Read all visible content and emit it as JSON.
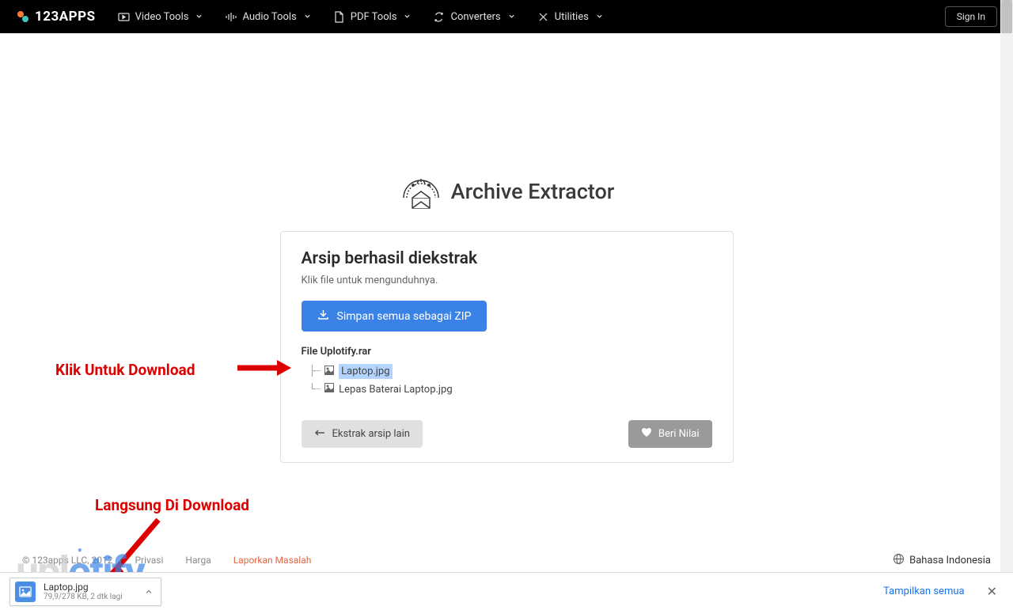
{
  "header": {
    "logo_text": "123APPS",
    "nav": {
      "video": "Video Tools",
      "audio": "Audio Tools",
      "pdf": "PDF Tools",
      "converters": "Converters",
      "utilities": "Utilities"
    },
    "sign_in": "Sign In"
  },
  "app": {
    "title": "Archive Extractor"
  },
  "card": {
    "title": "Arsip berhasil diekstrak",
    "subtitle": "Klik file untuk mengunduhnya.",
    "save_zip_btn": "Simpan semua sebagai ZIP",
    "file_header": "File Uplotify.rar",
    "files": {
      "item1": "Laptop.jpg",
      "item2": "Lepas Baterai Laptop.jpg"
    },
    "extract_btn": "Ekstrak arsip lain",
    "rate_btn": "Beri Nilai"
  },
  "annotations": {
    "click_download": "Klik Untuk Download",
    "direct_download": "Langsung Di Download"
  },
  "footer": {
    "copyright": "© 123apps LLC, 2012",
    "privacy": "Privasi",
    "pricing": "Harga",
    "report": "Laporkan Masalah",
    "language": "Bahasa Indonesia"
  },
  "watermark": {
    "part1": "upl",
    "part2": "o",
    "part3": "tify"
  },
  "download_bar": {
    "file_name": "Laptop.jpg",
    "status": "79,9/278 KB, 2 dtk lagi",
    "show_all": "Tampilkan semua"
  }
}
